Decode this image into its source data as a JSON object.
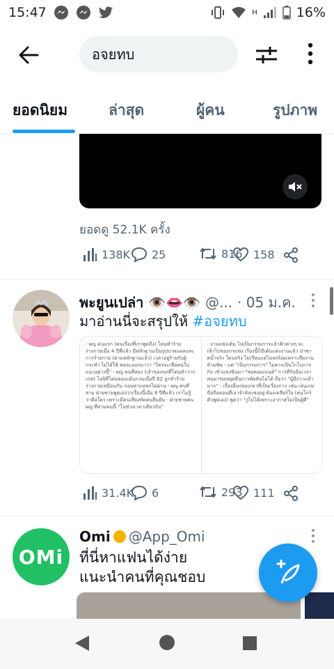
{
  "status_bar": {
    "time": "15:47",
    "battery": "16%",
    "network": "H"
  },
  "search": {
    "query": "อจยทบ"
  },
  "tabs": [
    {
      "label": "ยอดนิยม",
      "active": true
    },
    {
      "label": "ล่าสุด",
      "active": false
    },
    {
      "label": "ผู้คน",
      "active": false
    },
    {
      "label": "รูปภาพ",
      "active": false
    }
  ],
  "tweet1": {
    "views_text": "ยอดดู 52.1K ครั้ง",
    "stats": {
      "views": "138K",
      "replies": "25",
      "retweets": "816",
      "likes": "158"
    }
  },
  "tweet2": {
    "name": "พะยูนเปล่า 👁️👄👁️",
    "handle": "@...",
    "date": "· 05 ม.ค.",
    "text": "มาอ่านนี่จะสรุปให้",
    "hashtag": "#อจยทบ",
    "doc_left": "- ผญ คนแรก (คนเรื่องที่เราพูดถึง) โดนทำร้ายร่างกายเมื่อ 4 ปีที่แล้ว มีหลักฐานเป็นรูปบาดแผลและการร้ายกาย (ตามหลักฐานแล้ว) เวลาอยู่ร้ายกับผู้กระทำ ไม่ได้ใช้ พอจะออกมาว่า \"ใครจะเชื่อคนในแนวอย่างนี้\" - ผญ คนที่สอง (เจ้าของบทที่โดนทำว่ากเกท) โอจิที่โดนคอมเม้นกวนเมื่อปี 62 ถูกทำร้ายร่างกายเหมือนกัน ก่อนหาแหลกไม่ผ่าน - ผญ คนที่สาม ฝ่ายชายพูดเองว่าเรื่องนี้เมื่อ 8 ปีที่แล้ว เราไม่รู้ว่าคือใคร เพราะมีคนเสียงทัดคนยืนยัน - ฝ่ายชายคน ผญ ที่สามคนนี้ \"ในช่วงเวลาเดียวกัน\"",
    "doc_right": "- งานแซ่งเต้น ไปเป็นกรรมการแล้วฟ้าต่างๆ จะเข้าไปของกรแข่ง เรื่องนี้ก็มีเต้นแต่งงานแล้ว ปาซาตน้ำจริง โดนจริง ไม่เรียนแต่ไม่ลงร้อยเพราะทีมงานห้ามพิษ - แต่ \"เป็นกรรมการ\" ไม่ควรเป็นโกโบการกิจ เข้าแข่งขันมา \"ซอคอมเมนต์\" การที่รับมือเวลาคนมาขอหยุดยืนการตัดสินไม่ได้ ถือว่า \"ผู้มีภาวะต่ำมาก\" - เรื่องอื่นๆของเขาที่เป็นเรื่องการ เช่น เล่นเกม มือถือตอนที่เอาจำลังแข่งอยู่ ต้องเคลียร์ใจ (คนโกร์ตัวพูดเอง) พูดว่า \"กูไม่ได้เพราะอากาศไม่เป็นผู้ดี\""
  },
  "tweet2_stats": {
    "views": "31.4K",
    "replies": "6",
    "retweets": "293",
    "likes": "111"
  },
  "tweet3": {
    "name": "Omi",
    "handle": "@App_Omi",
    "logo_text": "OMi",
    "line1": "ที่นี่หาแฟนได้ง่าย",
    "line2": "แนะนำคนที่คุณชอบ"
  },
  "colors": {
    "accent": "#1d9bf0",
    "omi_green": "#21c064",
    "text": "#0f1419",
    "muted": "#536471"
  }
}
